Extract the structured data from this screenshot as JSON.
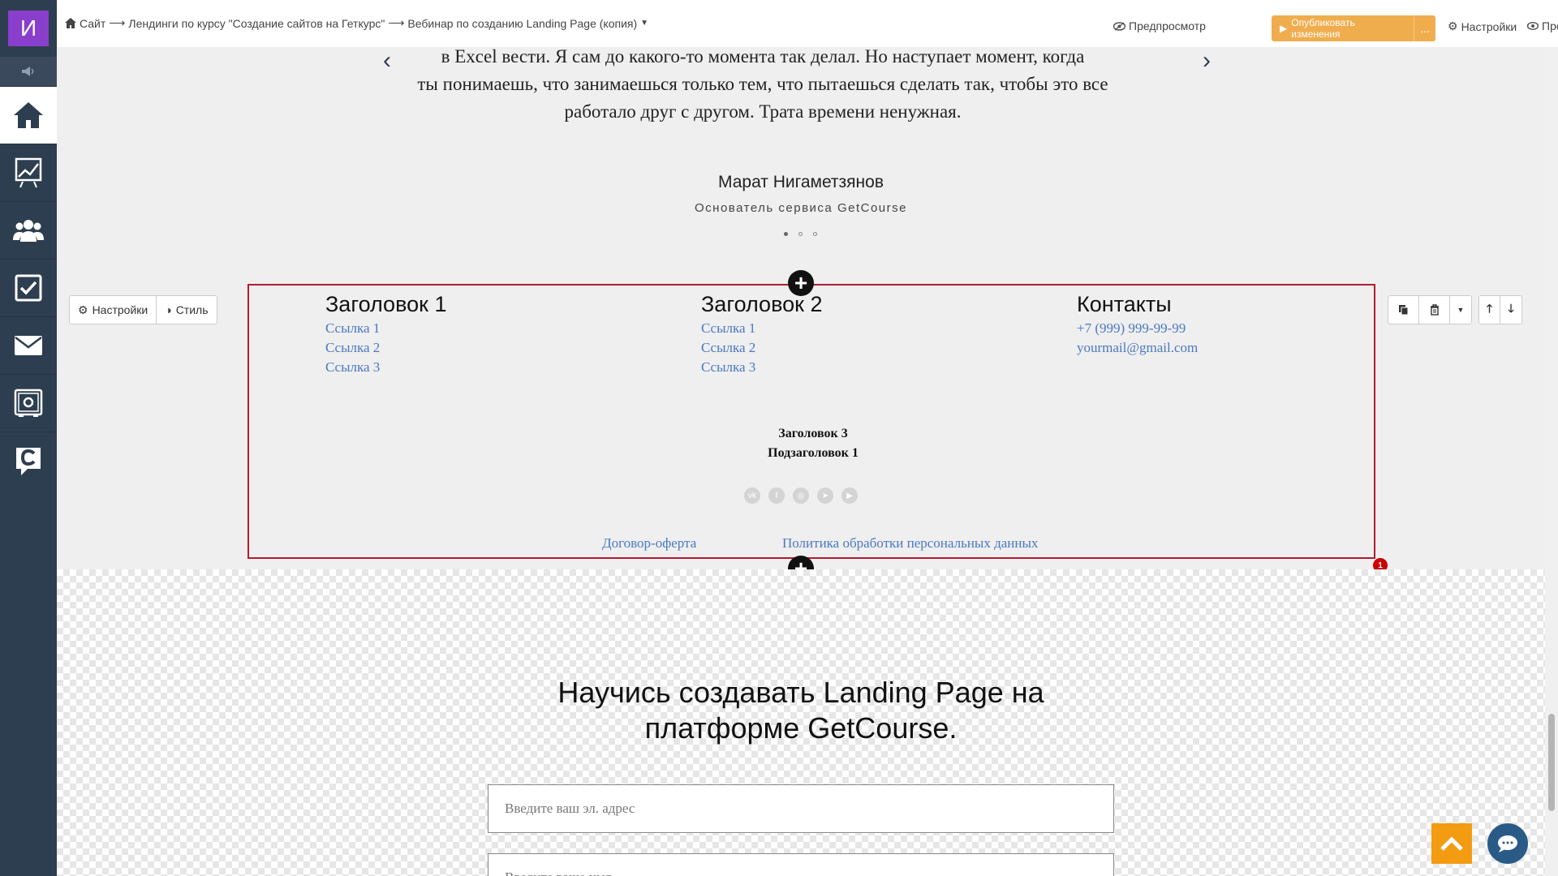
{
  "sidebar": {
    "avatar_letter": "И",
    "items": [
      {
        "icon": "home-icon"
      },
      {
        "icon": "chart-icon"
      },
      {
        "icon": "users-icon"
      },
      {
        "icon": "checkbox-icon"
      },
      {
        "icon": "mail-icon"
      },
      {
        "icon": "safe-icon"
      },
      {
        "icon": "getcourse-logo-icon"
      }
    ]
  },
  "topbar": {
    "breadcrumb": [
      "Сайт",
      "Лендинги по курсу \"Создание сайтов на Геткурс\"",
      "Вебинар по созданию Landing Page (копия)"
    ],
    "preview_label": "Предпросмотр",
    "publish_label": "Опубликовать изменения",
    "publish_more": "...",
    "settings_label": "Настройки",
    "view_label": "Просмотр"
  },
  "testimonial": {
    "quote_line1": "в Excel вести. Я сам до какого-то момента так делал. Но наступает момент, когда",
    "quote_line2": "ты понимаешь, что занимаешься только тем, что пытаешься сделать так, чтобы это все",
    "quote_line3": "работало друг с другом. Трата времени ненужная.",
    "author_name": "Марат Нигаметзянов",
    "author_role": "Основатель сервиса GetCourse"
  },
  "block_controls": {
    "settings_label": "Настройки",
    "style_label": "Стиль"
  },
  "footer": {
    "col1": {
      "title": "Заголовок 1",
      "links": [
        "Ссылка 1",
        "Ссылка 2",
        "Ссылка 3"
      ]
    },
    "col2": {
      "title": "Заголовок 2",
      "links": [
        "Ссылка 1",
        "Ссылка 2",
        "Ссылка 3"
      ]
    },
    "col3": {
      "title": "Контакты",
      "phone": "+7 (999) 999-99-99",
      "email": "yourmail@gmail.com"
    },
    "heading3": "Заголовок 3",
    "subheading1": "Подзаголовок 1",
    "social": [
      "vk-icon",
      "facebook-icon",
      "instagram-icon",
      "telegram-icon",
      "youtube-icon"
    ],
    "legal_offer": "Договор-оферта",
    "legal_privacy": "Политика обработки персональных данных"
  },
  "badge_count": "1",
  "form": {
    "title_line1": "Научись создавать Landing Page на",
    "title_line2": "платформе GetCourse.",
    "email_placeholder": "Введите ваш эл. адрес",
    "name_placeholder": "Введите ваше имя"
  },
  "colors": {
    "accent": "#f0ad4e",
    "sidebar": "#2d3e50",
    "link": "#4a78c2",
    "selection": "#b01c2e"
  }
}
